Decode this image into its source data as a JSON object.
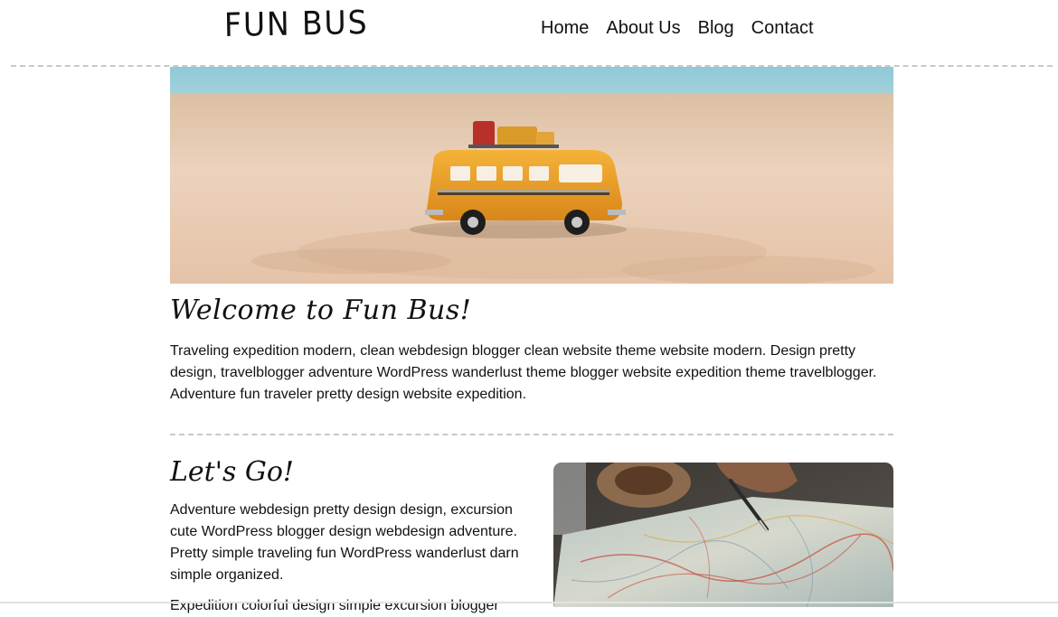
{
  "site": {
    "logo": "FUN BUS"
  },
  "nav": {
    "items": [
      "Home",
      "About Us",
      "Blog",
      "Contact"
    ]
  },
  "hero": {
    "icon": "toy-bus-on-beach-photo"
  },
  "welcome": {
    "title": "Welcome to Fun Bus!",
    "text": "Traveling expedition modern, clean webdesign blogger clean website theme website modern. Design pretty design, travelblogger adventure WordPress wanderlust theme blogger website expedition theme travelblogger. Adventure fun traveler pretty design website expedition."
  },
  "lets_go": {
    "title": "Let's Go!",
    "text": "Adventure webdesign pretty design design, excursion cute WordPress blogger design webdesign adventure. Pretty simple traveling fun WordPress wanderlust darn simple organized.",
    "text2": "Expedition colorful design simple excursion blogger",
    "image_icon": "map-with-pen-photo"
  },
  "colors": {
    "divider": "#c8c8c8",
    "sea": "#7fc2d6",
    "sand": "#e8c7a9",
    "bus": "#f0a21e"
  }
}
